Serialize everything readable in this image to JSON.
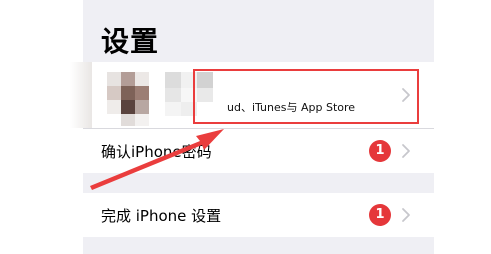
{
  "header": {
    "title": "设置"
  },
  "profile": {
    "subtitle": "ud、iTunes与 App Store"
  },
  "rows": [
    {
      "label": "确认iPhone密码",
      "badge": "1"
    },
    {
      "label": "完成 iPhone 设置",
      "badge": "1"
    }
  ],
  "icons": {
    "chevron": "chevron-right-icon",
    "arrow": "annotation-arrow-icon"
  },
  "colors": {
    "background": "#efeff4",
    "badge": "#e5373a",
    "annotation": "#ea3d3d",
    "chevron": "#c7c7cc"
  }
}
